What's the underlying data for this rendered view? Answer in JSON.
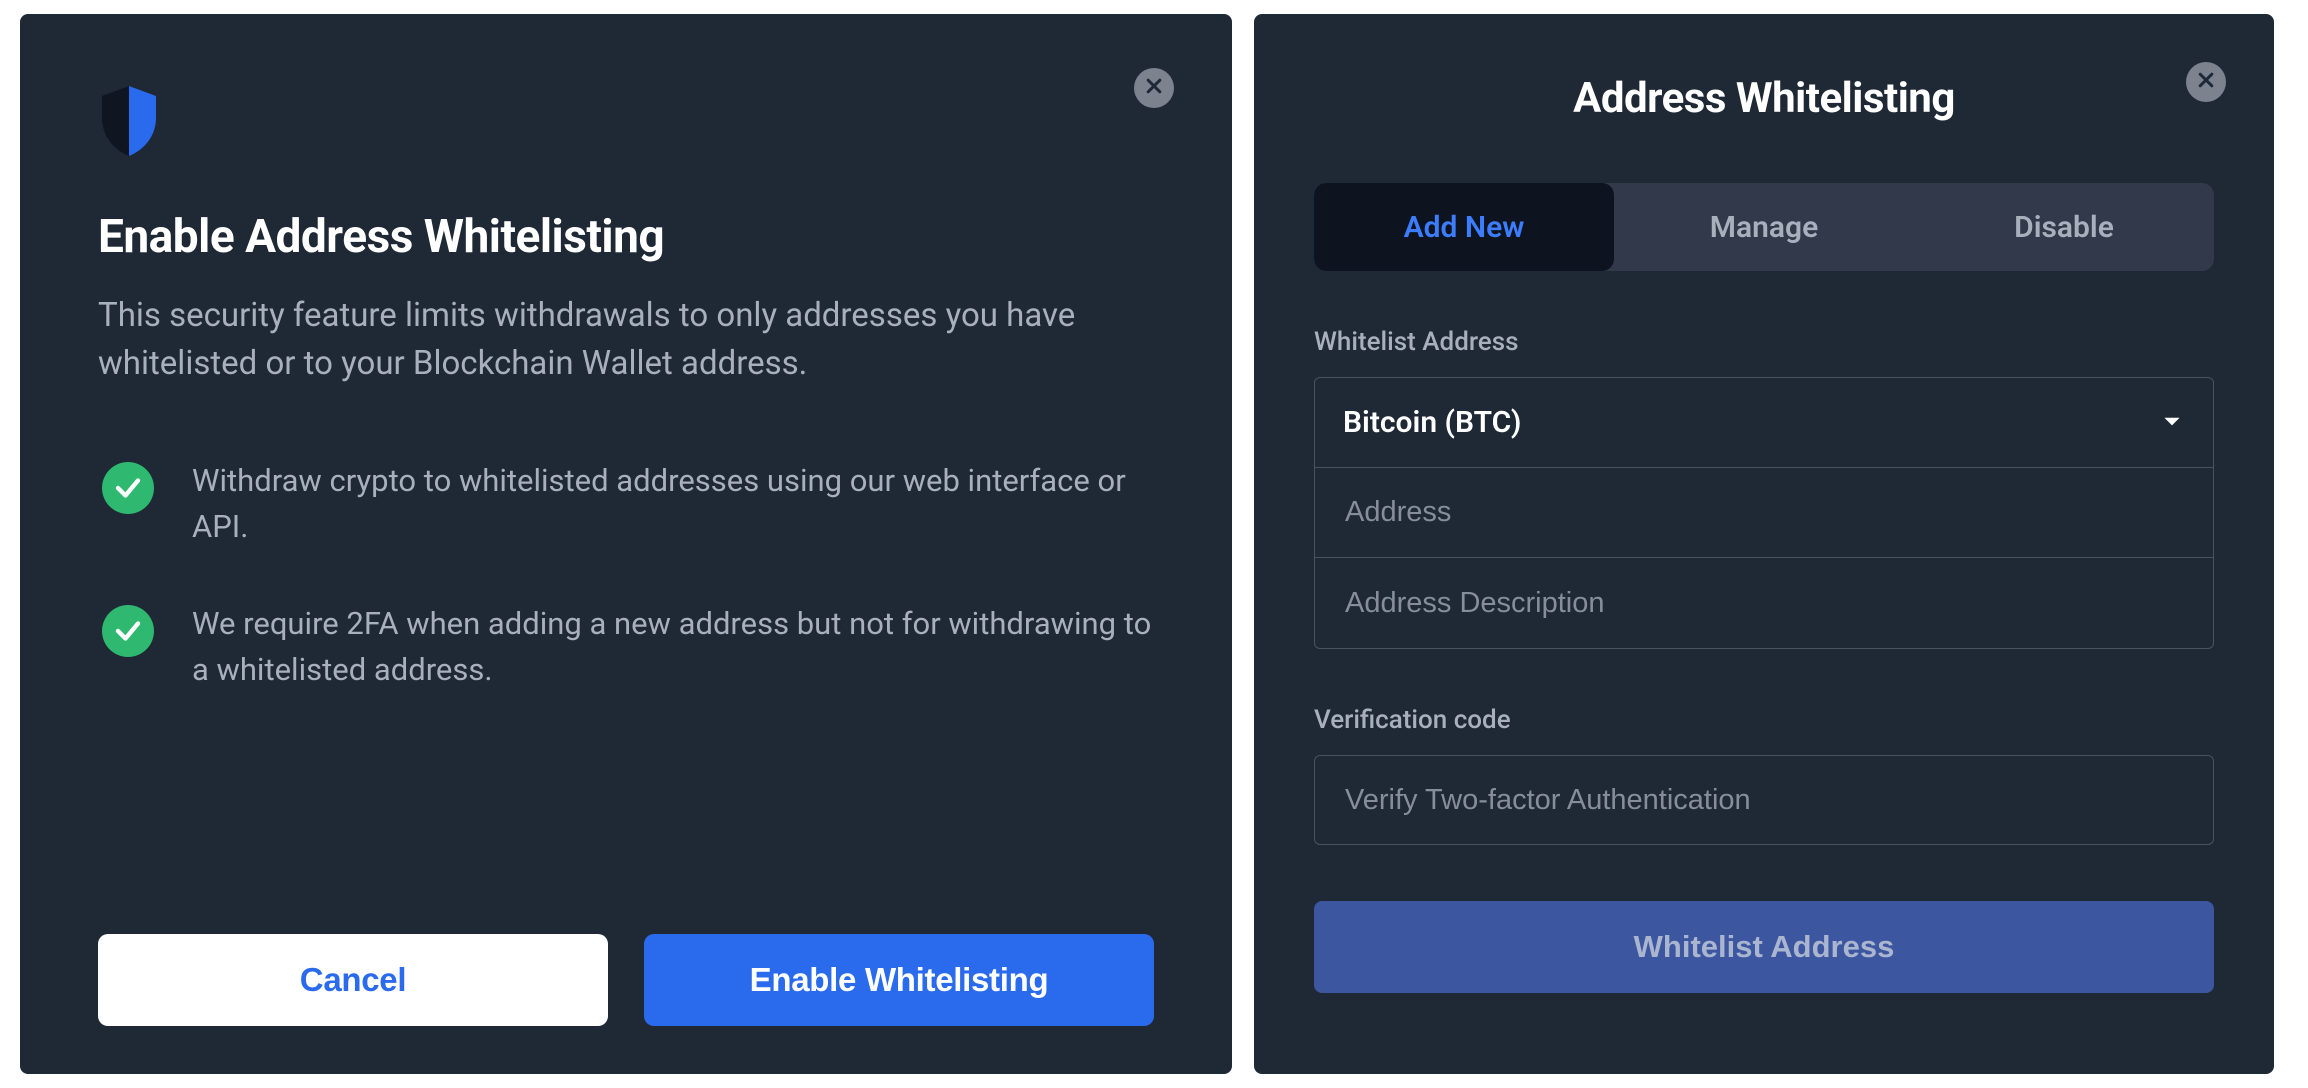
{
  "left": {
    "title": "Enable Address Whitelisting",
    "description": "This security feature limits withdrawals to only addresses you have whitelisted or to your Blockchain Wallet address.",
    "features": [
      "Withdraw crypto to whitelisted addresses using our web interface or API.",
      "We require 2FA when adding a new address but not for withdrawing to a whitelisted address."
    ],
    "buttons": {
      "cancel": "Cancel",
      "enable": "Enable Whitelisting"
    }
  },
  "right": {
    "title": "Address Whitelisting",
    "tabs": [
      {
        "label": "Add New",
        "active": true
      },
      {
        "label": "Manage",
        "active": false
      },
      {
        "label": "Disable",
        "active": false
      }
    ],
    "whitelist": {
      "section_label": "Whitelist Address",
      "currency_selected": "Bitcoin (BTC)",
      "address_placeholder": "Address",
      "description_placeholder": "Address Description"
    },
    "verification": {
      "section_label": "Verification code",
      "placeholder": "Verify Two-factor Authentication"
    },
    "submit_label": "Whitelist Address"
  },
  "icons": {
    "shield": "shield-icon",
    "close": "close-icon",
    "check": "check-icon",
    "caret_down": "chevron-down-icon"
  },
  "colors": {
    "accent_blue": "#2a6bed",
    "accent_green": "#2fb870",
    "panel_bg": "#1f2835"
  }
}
